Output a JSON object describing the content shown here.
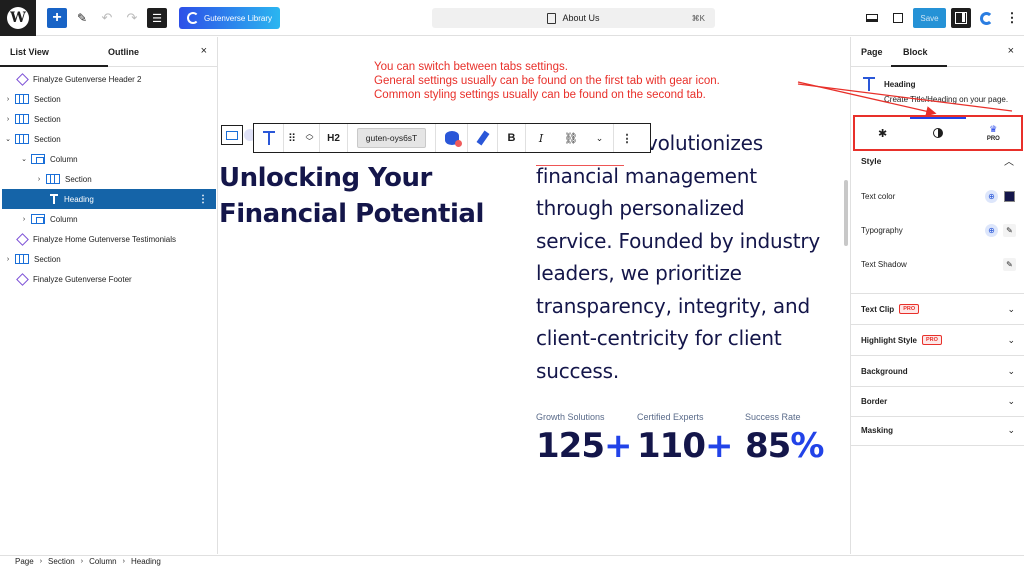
{
  "topbar": {
    "library_label": "Gutenverse Library",
    "document_title": "About Us",
    "shortcut": "⌘K",
    "save_label": "Save"
  },
  "left_panel": {
    "tab_list_view": "List View",
    "tab_outline": "Outline",
    "close": "×",
    "tree": [
      {
        "label": "Finalyze Gutenverse Header 2"
      },
      {
        "label": "Section"
      },
      {
        "label": "Section"
      },
      {
        "label": "Section"
      },
      {
        "label": "Column"
      },
      {
        "label": "Section"
      },
      {
        "label": "Heading"
      },
      {
        "label": "Column"
      },
      {
        "label": "Finalyze Home Gutenverse Testimonials"
      },
      {
        "label": "Section"
      },
      {
        "label": "Finalyze Gutenverse Footer"
      }
    ]
  },
  "annotation": {
    "line1": "You can switch between tabs settings.",
    "line2": "General settings usually can be found on the first tab with gear icon.",
    "line3": "Common styling settings usually can be found on the second tab."
  },
  "block_toolbar": {
    "heading_level": "H2",
    "class_name": "guten-oys6sT"
  },
  "canvas": {
    "heading_line1": "Unlocking Your",
    "heading_line2": "Financial Potential",
    "paragraph_lines": [
      "volutionizes",
      "financial management",
      "through personalized",
      "service. Founded by industry",
      "leaders, we prioritize",
      "transparency, integrity, and",
      "client-centricity for client",
      "success."
    ],
    "stats": [
      {
        "label": "Growth Solutions",
        "number": "125",
        "suffix": "+"
      },
      {
        "label": "Certified Experts",
        "number": "110",
        "suffix": "+"
      },
      {
        "label": "Success Rate",
        "number": "85",
        "suffix": "%"
      }
    ]
  },
  "right_panel": {
    "tab_page": "Page",
    "tab_block": "Block",
    "close": "×",
    "block_title": "Heading",
    "block_description": "Create Title/Heading on your page.",
    "pro_tab_label": "PRO",
    "section_style": "Style",
    "prop_text_color": "Text color",
    "prop_typography": "Typography",
    "prop_text_shadow": "Text Shadow",
    "pro_badge": "PRO",
    "accordions": [
      {
        "label": "Text Clip",
        "pro": true
      },
      {
        "label": "Highlight Style",
        "pro": true
      },
      {
        "label": "Background",
        "pro": false
      },
      {
        "label": "Border",
        "pro": false
      },
      {
        "label": "Masking",
        "pro": false
      }
    ],
    "text_color_value": "#14164a"
  },
  "breadcrumb": [
    "Page",
    "Section",
    "Column",
    "Heading"
  ],
  "colors": {
    "annotation": "#e8302a",
    "heading": "#14164a",
    "accent": "#2243e8",
    "selection": "#1564a8"
  }
}
